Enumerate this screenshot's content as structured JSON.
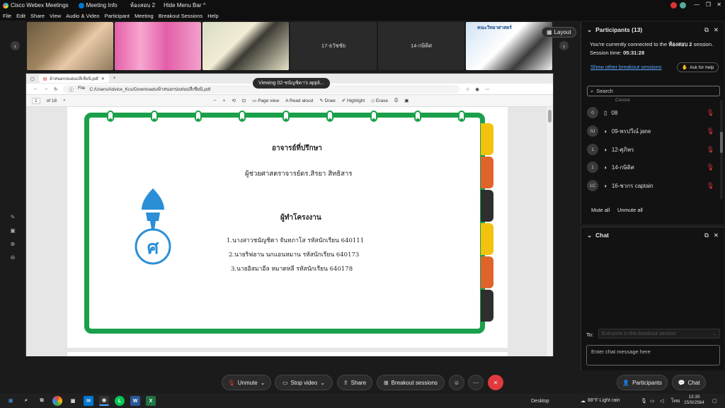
{
  "window": {
    "app_title": "Cisco Webex Meetings",
    "meeting_info": "Meeting Info",
    "room": "ห้องสอบ 2",
    "hide_menu": "Hide Menu Bar"
  },
  "menu": [
    "File",
    "Edit",
    "Share",
    "View",
    "Audio & Video",
    "Participant",
    "Meeting",
    "Breakout Sessions",
    "Help"
  ],
  "video_tiles": [
    {
      "label": ""
    },
    {
      "label": ""
    },
    {
      "label": ""
    },
    {
      "label": "17-ธวัชชัย"
    },
    {
      "label": "14-กษิดิศ"
    },
    {
      "label": "คณะวิทยาศาสตร์"
    }
  ],
  "layout_button": "Layout",
  "viewing_pill": "Viewing 02-ชนัญชิดา's appli...",
  "browser": {
    "tab_title": "ผ้าสนอกปแผ่นปลีเซียนิ.pdf",
    "file_label": "File",
    "path": "C:/Users/Advice_Kcs/Downloads/ผ้าสนอกปแผ่นปลีเซียนิ.pdf",
    "page_current": "1",
    "page_total": "of 18",
    "toolbar": [
      "Page view",
      "Read aloud",
      "Draw",
      "Highlight",
      "Erase"
    ]
  },
  "pdf": {
    "advisor_title": "อาจารย์ที่ปรึกษา",
    "advisor_name": "ผู้ช่วยศาสตราจารย์ดร.สิรยา สิทธิสาร",
    "team_title": "ผู้ทำโครงงาน",
    "members": [
      "1.นางสาวชนัญชิดา จันทภาโส     รหัสนักเรียน 640111",
      "2.นายริฟฮาน นกแอนหมาน      รหัสนักเรียน 640173",
      "3.นายอิสมาอีล หมาดหลี        รหัสนักเรียน 640178"
    ],
    "logo_text": "ศ",
    "tab_colors": [
      "#f2c20e",
      "#e0632c",
      "#2e2e2e",
      "#f2c20e",
      "#e0632c",
      "#2e2e2e"
    ]
  },
  "participants": {
    "title": "Participants (13)",
    "connected_prefix": "You're currently connected to the",
    "connected_room": "ห้องสอบ 2",
    "connected_suffix": "session.",
    "session_time_label": "Session time:",
    "session_time": "05:31:28",
    "show_other": "Show other breakout sessions",
    "ask_help": "Ask for help",
    "search_placeholder": "Search",
    "partial_row": "Conost",
    "rows": [
      {
        "avatar": "0",
        "name": "08"
      },
      {
        "avatar": "0J",
        "name": "09-พรปวีณ์ jane"
      },
      {
        "avatar": "1",
        "name": "12-ศุภิพร"
      },
      {
        "avatar": "1",
        "name": "14-กษิดิศ"
      },
      {
        "avatar": "1C",
        "name": "16-ชวกร captain"
      }
    ],
    "mute_all": "Mute all",
    "unmute_all": "Unmute all"
  },
  "chat": {
    "title": "Chat",
    "to_label": "To:",
    "to_value": "Everyone in this breakout session",
    "input_placeholder": "Enter chat message here"
  },
  "controls": {
    "unmute": "Unmute",
    "stop_video": "Stop video",
    "share": "Share",
    "breakout": "Breakout sessions",
    "participants": "Participants",
    "chat": "Chat"
  },
  "taskbar": {
    "desktop": "Desktop",
    "weather": "88°F  Light rain",
    "lang": "ไทย",
    "time": "13:35",
    "date": "25/9/2564"
  },
  "colors": {
    "accent": "#1aa04a",
    "end": "#e0393e",
    "link": "#5aa7ff"
  }
}
